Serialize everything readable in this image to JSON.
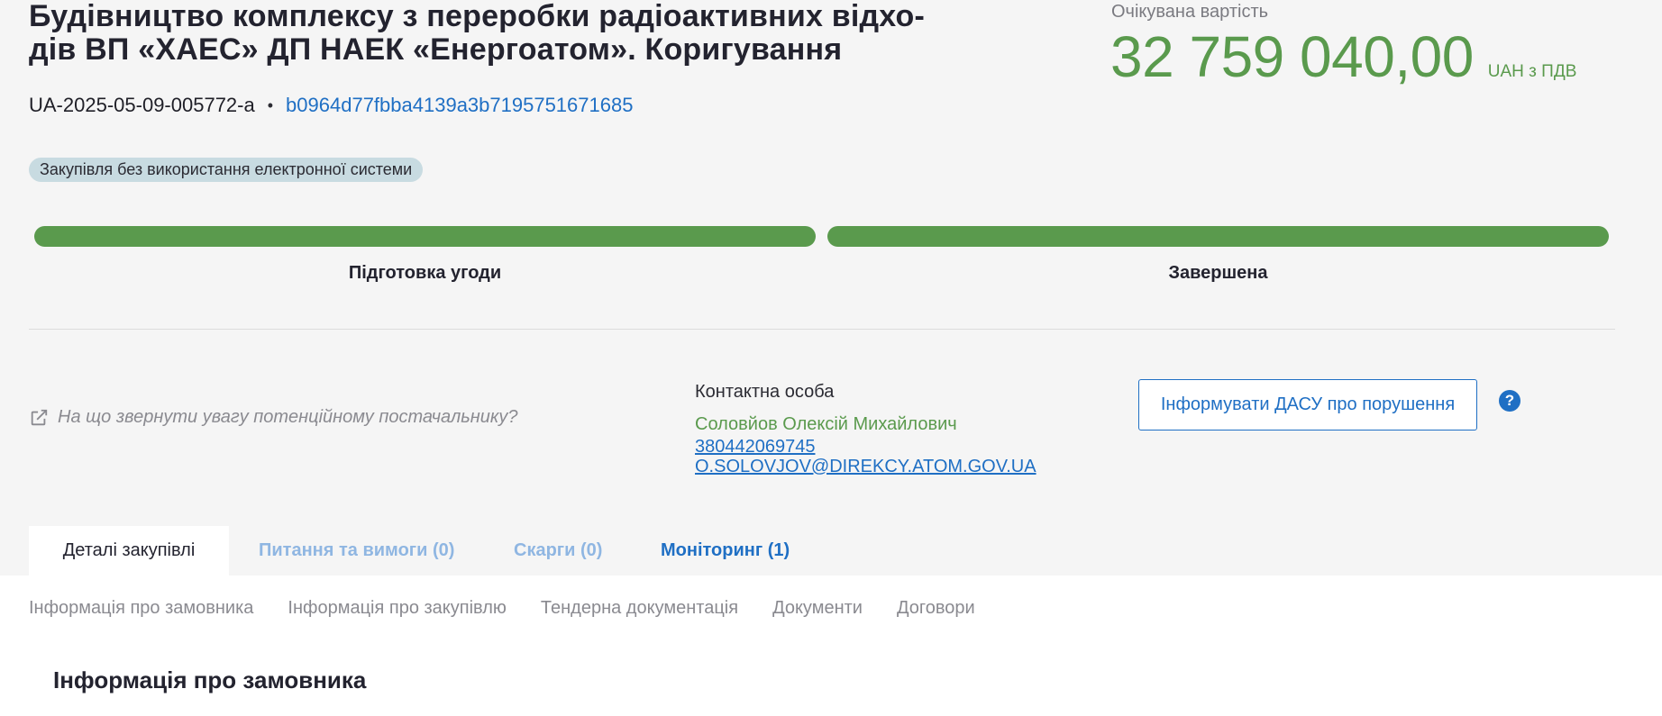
{
  "tender": {
    "title": "Будівництво комплексу з переробки радіоактивних відхо-дів ВП «ХАЕС» ДП НАЕК «Енергоатом». Коригування",
    "id": "UA-2025-05-09-005772-a",
    "separator": "•",
    "hash": "b0964d77fbba4139a3b7195751671685",
    "badge": "Закупівля без використання електронної системи"
  },
  "price": {
    "label": "Очікувана вартість",
    "value": "32 759 040,00",
    "currency": "UAH з ПДВ"
  },
  "stages": [
    {
      "label": "Підготовка угоди",
      "progress": 1.0
    },
    {
      "label": "Завершена",
      "progress": 1.0
    }
  ],
  "hint": {
    "text": "На що звернути увагу потенційному постачальнику?",
    "icon": "external-link-icon"
  },
  "contact": {
    "label": "Контактна особа",
    "name": "Соловйов Олексій Михайлович",
    "phone": "380442069745",
    "email": "O.SOLOVJOV@DIREKCY.ATOM.GOV.UA"
  },
  "actions": {
    "dasu_button": "Інформувати ДАСУ про порушення",
    "help": "?"
  },
  "tabs": [
    {
      "label": "Деталі закупівлі",
      "active": true
    },
    {
      "label": "Питання та вимоги (0)"
    },
    {
      "label": "Скарги (0)"
    },
    {
      "label": "Моніторинг (1)"
    }
  ],
  "subnav": [
    "Інформація про замовника",
    "Інформація про закупівлю",
    "Тендерна документація",
    "Документи",
    "Договори"
  ],
  "section_title": "Інформація про замовника",
  "colors": {
    "accent_green": "#5a9a4d",
    "link_blue": "#1f6fc4",
    "badge_bg": "#c8dbe1"
  }
}
